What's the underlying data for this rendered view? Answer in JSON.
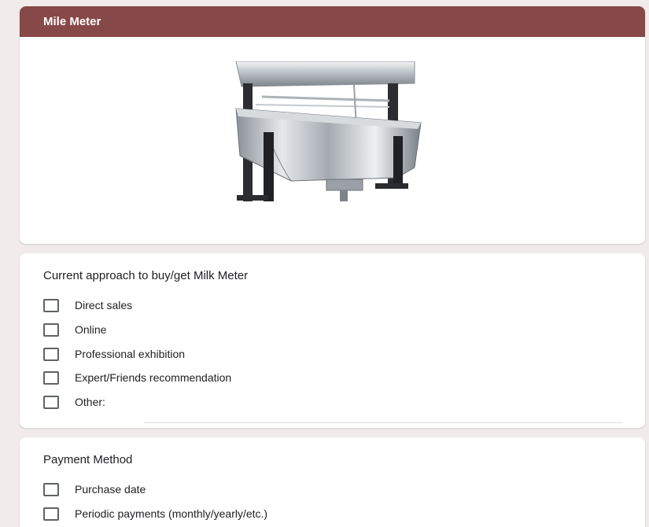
{
  "section": {
    "title": "Mile Meter",
    "header_color": "#874848",
    "image": "milk-meter-product-photo"
  },
  "question1": {
    "title": "Current approach to buy/get Milk Meter",
    "options": [
      {
        "label": "Direct sales"
      },
      {
        "label": "Online"
      },
      {
        "label": "Professional exhibition"
      },
      {
        "label": "Expert/Friends recommendation"
      },
      {
        "label": "Other:"
      }
    ],
    "other_value": ""
  },
  "question2": {
    "title": "Payment Method",
    "options": [
      {
        "label": "Purchase date"
      },
      {
        "label": "Periodic payments (monthly/yearly/etc.)"
      }
    ]
  }
}
